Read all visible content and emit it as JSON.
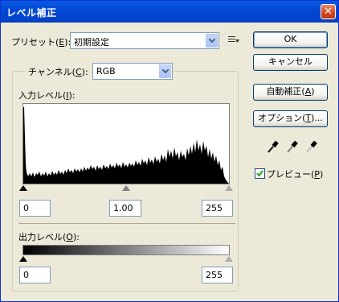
{
  "window": {
    "title": "レベル補正",
    "close_glyph": "✕"
  },
  "preset": {
    "label": "プリセット(",
    "key": "E",
    "label_end": "):",
    "value": "初期設定"
  },
  "channel": {
    "label": "チャンネル(",
    "key": "C",
    "label_end": "):",
    "value": "RGB"
  },
  "input_levels": {
    "label": "入力レベル(",
    "key": "I",
    "label_end": "):",
    "black": "0",
    "gamma": "1.00",
    "white": "255"
  },
  "output_levels": {
    "label": "出力レベル(",
    "key": "O",
    "label_end": "):",
    "black": "0",
    "white": "255"
  },
  "buttons": {
    "ok": "OK",
    "cancel": "キャンセル",
    "auto_pre": "自動補正(",
    "auto_key": "A",
    "auto_post": ")",
    "options_pre": "オプション(",
    "options_key": "T",
    "options_post": ")..."
  },
  "preview": {
    "label_pre": "プレビュー(",
    "key": "P",
    "label_post": ")",
    "checked": true
  },
  "eyedroppers": [
    "black-eyedropper-icon",
    "gray-eyedropper-icon",
    "white-eyedropper-icon"
  ],
  "colors": {
    "title_bar": "#0249d6",
    "dialog_bg": "#ece9d8",
    "field_border": "#7f9db9"
  }
}
